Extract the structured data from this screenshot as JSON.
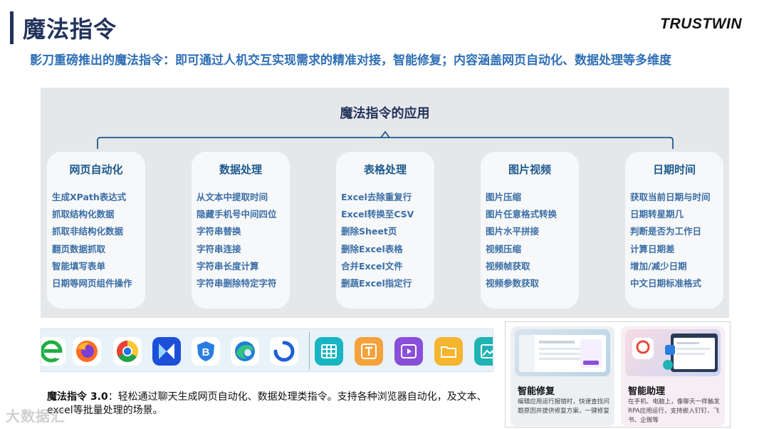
{
  "header": {
    "title": "魔法指令",
    "brand": "TRUSTWIN",
    "subtitle": "影刀重磅推出的魔法指令：即可通过人机交互实现需求的精准对接，智能修复；内容涵盖网页自动化、数据处理等多维度"
  },
  "panel": {
    "title": "魔法指令的应用",
    "cards": [
      {
        "title": "网页自动化",
        "items": [
          "生成XPath表达式",
          "抓取结构化数据",
          "抓取非结构化数据",
          "翻页数据抓取",
          "智能填写表单",
          "日期等网页组件操作"
        ]
      },
      {
        "title": "数据处理",
        "items": [
          "从文本中提取时间",
          "隐藏手机号中间四位",
          "字符串替换",
          "字符串连接",
          "字符串长度计算",
          "字符串删除特定字符"
        ]
      },
      {
        "title": "表格处理",
        "items": [
          "Excel去除重复行",
          "Excel转换至CSV",
          "删除Sheet页",
          "删除Excel表格",
          "合并Excel文件",
          "删蔬Excel指定行"
        ]
      },
      {
        "title": "图片视频",
        "items": [
          "图片压缩",
          "图片任意格式转换",
          "图片水平拼接",
          "视频压缩",
          "视频帧获取",
          "视频参数获取"
        ]
      },
      {
        "title": "日期时间",
        "items": [
          "获取当前日期与时间",
          "日期转星期几",
          "判断是否为工作日",
          "计算日期差",
          "增加/减少日期",
          "中文日期标准格式"
        ]
      }
    ]
  },
  "dock": {
    "icons": [
      "ie-browser-icon",
      "firefox-icon",
      "chrome-icon",
      "yingdao-icon",
      "shield-browser-icon",
      "edge-icon",
      "blue-circle-app-icon",
      "table-app-icon",
      "text-app-icon",
      "video-app-icon",
      "folder-app-icon",
      "image-app-icon"
    ],
    "colors": {
      "background": "#e8f2f9",
      "teal": "#18b5c2",
      "orange": "#f5a23a",
      "purple": "#8a4fd8"
    }
  },
  "description": {
    "label": "魔法指令 3.0",
    "text": "：轻松通过聊天生成网页自动化、数据处理类指令。支持各种浏览器自动化，及文本、excel等批量处理的场景。"
  },
  "features": [
    {
      "title": "智能修复",
      "desc": "编辑应用运行报错时，快速查找问题原因并提供修复方案，一键修复"
    },
    {
      "title": "智能助理",
      "desc": "在手机、电脑上，像聊天一样触发RPA应用运行，支持嵌入钉钉、飞书、企微等"
    }
  ],
  "watermark": "大数据汇"
}
